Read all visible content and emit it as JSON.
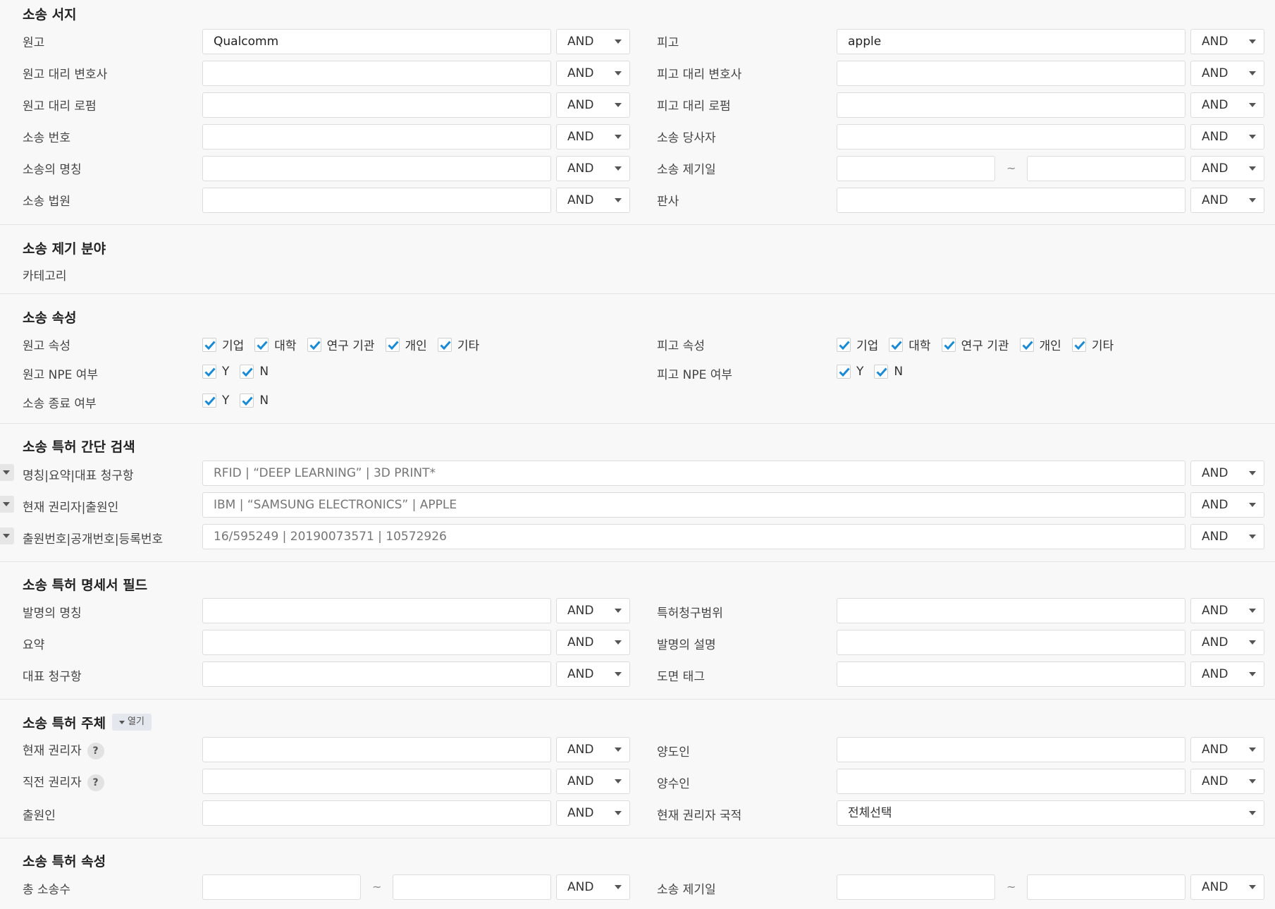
{
  "litigation_doc": {
    "title": "소송 서지",
    "rows": [
      {
        "left_label": "원고",
        "left_value": "Qualcomm",
        "left_op": "AND",
        "right_label": "피고",
        "right_value": "apple",
        "right_op": "AND"
      },
      {
        "left_label": "원고 대리 변호사",
        "left_value": "",
        "left_op": "AND",
        "right_label": "피고 대리 변호사",
        "right_value": "",
        "right_op": "AND"
      },
      {
        "left_label": "원고 대리 로펌",
        "left_value": "",
        "left_op": "AND",
        "right_label": "피고 대리 로펌",
        "right_value": "",
        "right_op": "AND"
      },
      {
        "left_label": "소송 번호",
        "left_value": "",
        "left_op": "AND",
        "right_label": "소송 당사자",
        "right_value": "",
        "right_op": "AND"
      },
      {
        "left_label": "소송의 명칭",
        "left_value": "",
        "left_op": "AND",
        "right_label": "소송 제기일",
        "right_value": "",
        "right_op": "AND",
        "tilde": "~"
      },
      {
        "left_label": "소송 법원",
        "left_value": "",
        "left_op": "AND",
        "right_label": "판사",
        "right_value": "",
        "right_op": "AND"
      }
    ]
  },
  "field": {
    "title": "소송 제기 분야",
    "category_label": "카테고리"
  },
  "attributes": {
    "title": "소송 속성",
    "plaintiff_attr_label": "원고 속성",
    "defendant_attr_label": "피고 속성",
    "attr_options": [
      "기업",
      "대학",
      "연구 기관",
      "개인",
      "기타"
    ],
    "plaintiff_npe_label": "원고 NPE 여부",
    "defendant_npe_label": "피고 NPE 여부",
    "end_label": "소송 종료 여부",
    "yn_options": [
      "Y",
      "N"
    ],
    "check_color": "#1a8ad4"
  },
  "quick_search": {
    "title": "소송 특허 간단 검색",
    "rows": [
      {
        "label": "명칭|요약|대표 청구항",
        "placeholder": "RFID | “DEEP LEARNING” | 3D PRINT*",
        "op": "AND"
      },
      {
        "label": "현재 권리자|출원인",
        "placeholder": "IBM | “SAMSUNG ELECTRONICS” | APPLE",
        "op": "AND"
      },
      {
        "label": "출원번호|공개번호|등록번호",
        "placeholder": "16/595249 | 20190073571 | 10572926",
        "op": "AND"
      }
    ]
  },
  "spec_fields": {
    "title": "소송 특허 명세서 필드",
    "rows": [
      {
        "left_label": "발명의 명칭",
        "left_op": "AND",
        "right_label": "특허청구범위",
        "right_op": "AND"
      },
      {
        "left_label": "요약",
        "left_op": "AND",
        "right_label": "발명의 설명",
        "right_op": "AND"
      },
      {
        "left_label": "대표 청구항",
        "left_op": "AND",
        "right_label": "도면 태그",
        "right_op": "AND"
      }
    ]
  },
  "subject": {
    "title": "소송 특허 주체",
    "open_label": "열기",
    "help_glyph": "?",
    "rows": [
      {
        "left_label": "현재 권리자",
        "left_op": "AND",
        "right_label": "양도인",
        "right_op": "AND"
      },
      {
        "left_label": "직전 권리자",
        "left_op": "AND",
        "right_label": "양수인",
        "right_op": "AND"
      },
      {
        "left_label": "출원인",
        "left_op": "AND",
        "right_label": "현재 권리자 국적",
        "right_select": "전체선택"
      }
    ]
  },
  "patent_attr": {
    "title": "소송 특허 속성",
    "left_label": "총 소송수",
    "left_op": "AND",
    "right_label": "소송 제기일",
    "right_op": "AND",
    "tilde": "~"
  }
}
